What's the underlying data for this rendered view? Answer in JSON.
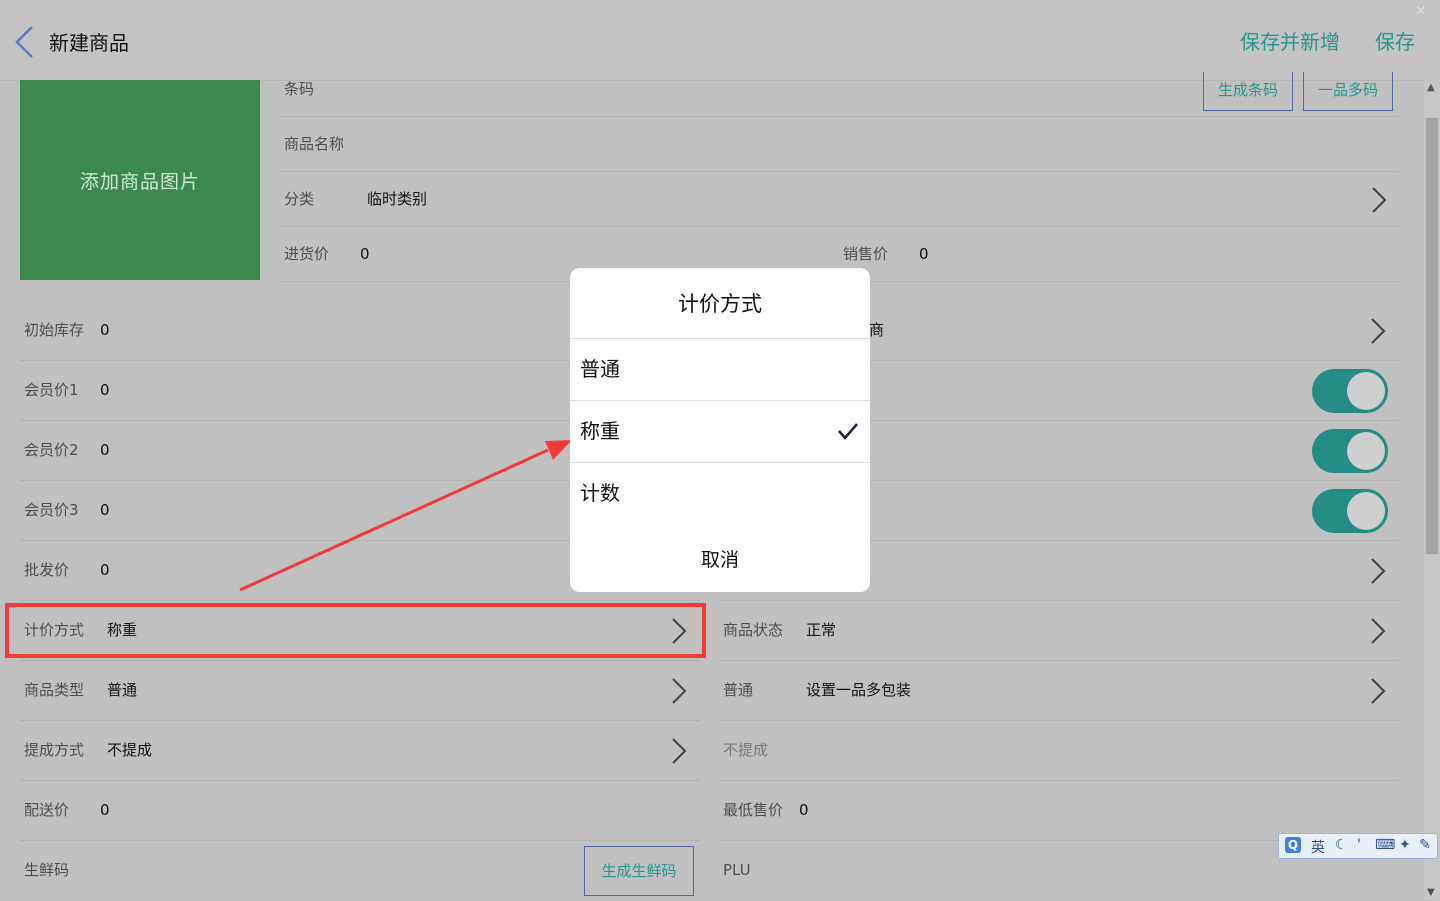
{
  "header": {
    "title": "新建商品",
    "save_and_new": "保存并新增",
    "save": "保存"
  },
  "image_placeholder": "添加商品图片",
  "top_fields": {
    "barcode_label": "条码",
    "gen_barcode": "生成条码",
    "multi_barcode": "一品多码",
    "name_label": "商品名称",
    "category_label": "分类",
    "category_value": "临时类别",
    "purchase_label": "进货价",
    "purchase_value": "0",
    "sale_label": "销售价",
    "sale_value": "0"
  },
  "left_rows": [
    {
      "label": "初始库存",
      "value": "0"
    },
    {
      "label": "会员价1",
      "value": "0"
    },
    {
      "label": "会员价2",
      "value": "0"
    },
    {
      "label": "会员价3",
      "value": "0"
    },
    {
      "label": "批发价",
      "value": "0"
    },
    {
      "label": "计价方式",
      "value": "称重"
    },
    {
      "label": "商品类型",
      "value": "普通"
    },
    {
      "label": "提成方式",
      "value": "不提成"
    },
    {
      "label": "配送价",
      "value": "0"
    },
    {
      "label": "生鲜码",
      "button": "生成生鲜码"
    }
  ],
  "right_rows": [
    {
      "value": "商"
    },
    {
      "label": "商品状态",
      "value": "正常"
    },
    {
      "label": "普通",
      "value": "设置一品多包装"
    },
    {
      "label": "不提成"
    },
    {
      "label": "最低售价",
      "value": "0"
    },
    {
      "label": "PLU"
    }
  ],
  "modal": {
    "title": "计价方式",
    "options": [
      "普通",
      "称重",
      "计数"
    ],
    "selected": "称重",
    "cancel": "取消"
  },
  "ime": {
    "lang": "英"
  },
  "colors": {
    "accent": "#26998f",
    "image_green": "#3b8a4c",
    "toggle": "#268c88",
    "highlight": "#f23a3a"
  }
}
